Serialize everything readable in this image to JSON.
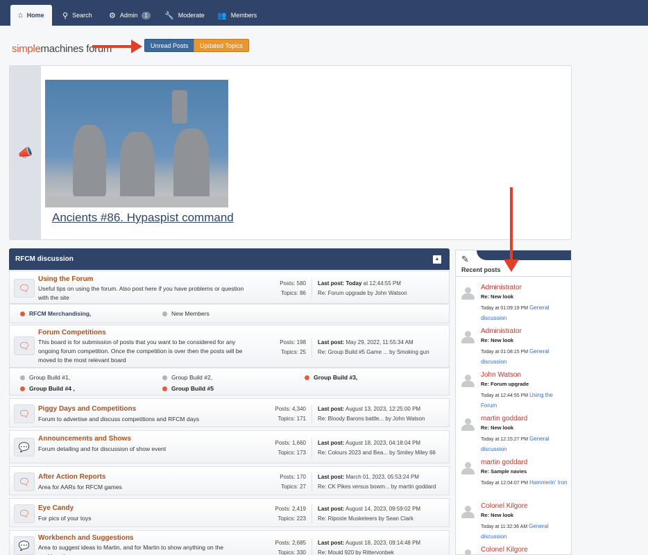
{
  "nav": {
    "tabs": [
      {
        "label": "Home",
        "icon": "home-icon"
      },
      {
        "label": "Search",
        "icon": "search-icon"
      },
      {
        "label": "Admin",
        "icon": "gear-icon",
        "badge": "1"
      },
      {
        "label": "Moderate",
        "icon": "wrench-icon"
      },
      {
        "label": "Members",
        "icon": "members-icon"
      }
    ]
  },
  "logo": {
    "part1": "simple",
    "part2": "machines forum"
  },
  "buttons": {
    "unread": "Unread Posts",
    "updated": "Updated Topics"
  },
  "news": {
    "link": "Ancients #86. Hypaspist command"
  },
  "category": {
    "title": "RFCM discussion"
  },
  "boards": [
    {
      "title": "Using the Forum",
      "desc": "Useful tips on using the forum. Also post here if you have problems or question with the site",
      "posts": "Posts: 580",
      "topics": "Topics: 86",
      "last_label": "Last post:",
      "last_when_bold": "Today",
      "last_when": " at 12:44:55 PM",
      "last_re": "Re: Forum upgrade by John Watson"
    },
    {
      "title": "Forum Competitions",
      "desc": "This board is for submission of posts that you want to be considered for any ongoing forum competition. Once the competition is over then the posts will be moved to the most relevant board",
      "posts": "Posts: 198",
      "topics": "Topics: 25",
      "last_label": "Last post:",
      "last_when": "May 29, 2022, 11:55:34 AM",
      "last_re": "Re: Group Build #5 Game ... by Smoking gun"
    },
    {
      "title": "Piggy Days and Competitions",
      "desc": "Forum to advertise and discuss competitions and RFCM days",
      "posts": "Posts: 4,340",
      "topics": "Topics: 171",
      "last_label": "Last post:",
      "last_when": "August 13, 2023, 12:25:00 PM",
      "last_re": "Re: Bloody Barons battle... by John Watson"
    },
    {
      "title": "Announcements and Shows",
      "desc": "Forum detailing and for discussion of show event",
      "posts": "Posts: 1,660",
      "topics": "Topics: 173",
      "last_label": "Last post:",
      "last_when": "August 18, 2023, 04:18:04 PM",
      "last_re": "Re: Colours 2023 and Bea... by Smiley Miley 66"
    },
    {
      "title": "After Action Reports",
      "desc": "Area for AARs for RFCM games",
      "posts": "Posts: 170",
      "topics": "Topics: 27",
      "last_label": "Last post:",
      "last_when": "March 01, 2023, 05:53:24 PM",
      "last_re": "Re: CK Pikes versus bowm... by martin goddard"
    },
    {
      "title": "Eye Candy",
      "desc": "For pics of your toys",
      "posts": "Posts: 2,419",
      "topics": "Topics: 223",
      "last_label": "Last post:",
      "last_when": "August 14, 2023, 09:59:02 PM",
      "last_re": "Re: Riposte Musketeers by Sean Clark"
    },
    {
      "title": "Workbench and Suggestions",
      "desc": "Area to suggest ideas to Martin, and for Martin to show anything on the workbench",
      "posts": "Posts: 2,685",
      "topics": "Topics: 330",
      "last_label": "Last post:",
      "last_when": "August 18, 2023, 09:14:48 PM",
      "last_re": "Re: Mould 920 by Rittervonbek"
    }
  ],
  "children1": [
    "RFCM Merchandising,",
    "New Members"
  ],
  "children2": [
    "Group Build #1,",
    "Group Build #2,",
    "Group Build #3,",
    "Group Build #4 ,",
    "Group Build #5"
  ],
  "recent": {
    "title": "Recent posts",
    "posts": [
      {
        "user": "Administrator",
        "subject": "Re: New look",
        "time": "Today at 01:09:19 PM",
        "board": "General discussion"
      },
      {
        "user": "Administrator",
        "subject": "Re: New look",
        "time": "Today at 01:08:15 PM",
        "board": "General discussion"
      },
      {
        "user": "John Watson",
        "subject": "Re: Forum upgrade",
        "time": "Today at 12:44:55 PM",
        "board": "Using the Forum"
      },
      {
        "user": "martin goddard",
        "subject": "Re: New look",
        "time": "Today at 12:15:27 PM",
        "board": "General discussion"
      },
      {
        "user": "martin goddard",
        "subject": "Re: Sample navies",
        "time": "Today at 12:04:07 PM",
        "board": "Hammerin' Iron"
      },
      {
        "user": "Colonel Kilgore",
        "subject": "Re: New look",
        "time": "Today at 11:32:36 AM",
        "board": "General discussion"
      },
      {
        "user": "Colonel Kilgore",
        "subject": "",
        "time": "",
        "board": ""
      }
    ]
  }
}
